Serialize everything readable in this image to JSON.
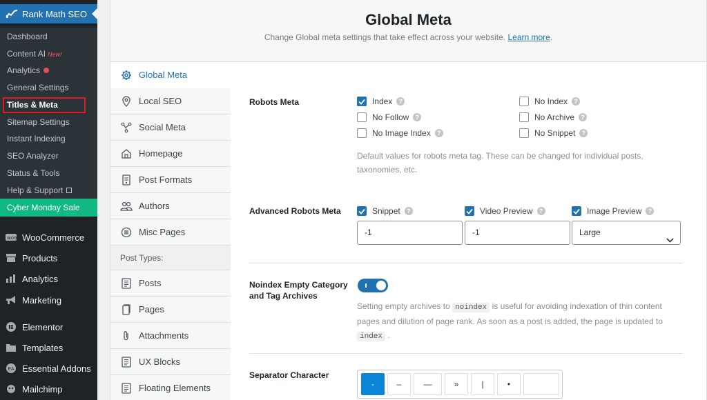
{
  "sidebar": {
    "plugin_title": "Rank Math SEO",
    "submenu": [
      {
        "label": "Dashboard"
      },
      {
        "label": "Content AI",
        "badge": "New!"
      },
      {
        "label": "Analytics"
      },
      {
        "label": "General Settings"
      },
      {
        "label": "Titles & Meta"
      },
      {
        "label": "Sitemap Settings"
      },
      {
        "label": "Instant Indexing"
      },
      {
        "label": "SEO Analyzer"
      },
      {
        "label": "Status & Tools"
      },
      {
        "label": "Help & Support"
      }
    ],
    "sale_label": "Cyber Monday Sale",
    "menu": [
      {
        "label": "WooCommerce",
        "icon": "woo-icon"
      },
      {
        "label": "Products",
        "icon": "archive-icon"
      },
      {
        "label": "Analytics",
        "icon": "bar-chart-icon"
      },
      {
        "label": "Marketing",
        "icon": "megaphone-icon"
      },
      {
        "label": "Elementor",
        "icon": "elementor-icon"
      },
      {
        "label": "Templates",
        "icon": "folder-icon"
      },
      {
        "label": "Essential Addons",
        "icon": "ea-icon"
      },
      {
        "label": "Mailchimp",
        "icon": "mailchimp-icon"
      }
    ]
  },
  "header": {
    "title": "Global Meta",
    "description": "Change Global meta settings that take effect across your website.",
    "learn_more": "Learn more",
    "period": "."
  },
  "nav": {
    "items": [
      {
        "label": "Global Meta",
        "icon": "gear-icon"
      },
      {
        "label": "Local SEO",
        "icon": "map-pin-icon"
      },
      {
        "label": "Social Meta",
        "icon": "share-icon"
      },
      {
        "label": "Homepage",
        "icon": "home-icon"
      },
      {
        "label": "Post Formats",
        "icon": "post-format-icon"
      },
      {
        "label": "Authors",
        "icon": "users-icon"
      },
      {
        "label": "Misc Pages",
        "icon": "list-icon"
      }
    ],
    "post_types_heading": "Post Types:",
    "post_types": [
      {
        "label": "Posts",
        "icon": "document-icon"
      },
      {
        "label": "Pages",
        "icon": "pages-icon"
      },
      {
        "label": "Attachments",
        "icon": "paperclip-icon"
      },
      {
        "label": "UX Blocks",
        "icon": "document-icon"
      },
      {
        "label": "Floating Elements",
        "icon": "document-icon"
      }
    ]
  },
  "robots_meta": {
    "label": "Robots Meta",
    "options": [
      {
        "label": "Index",
        "checked": true
      },
      {
        "label": "No Index",
        "checked": false
      },
      {
        "label": "No Follow",
        "checked": false
      },
      {
        "label": "No Archive",
        "checked": false
      },
      {
        "label": "No Image Index",
        "checked": false
      },
      {
        "label": "No Snippet",
        "checked": false
      }
    ],
    "description_line1": "Default values for robots meta tag. These can be changed for individual posts,",
    "description_line2": "taxonomies, etc."
  },
  "advanced_robots": {
    "label": "Advanced Robots Meta",
    "snippet_label": "Snippet",
    "snippet_value": "-1",
    "video_label": "Video Preview",
    "video_value": "-1",
    "image_label": "Image Preview",
    "image_value": "Large"
  },
  "noindex_empty": {
    "label_line1": "Noindex Empty Category",
    "label_line2": "and Tag Archives",
    "enabled": true,
    "desc_part1": "Setting empty archives to",
    "desc_code1": "noindex",
    "desc_part2": "is useful for avoiding indexation of thin content",
    "desc_line2": "pages and dilution of page rank. As soon as a post is added, the page is updated to",
    "desc_code2": "index",
    "desc_end": "."
  },
  "separator": {
    "label": "Separator Character",
    "options": [
      "-",
      "–",
      "—",
      "»",
      "|",
      "•"
    ],
    "selected": "-"
  },
  "colors": {
    "accent": "#2271b1",
    "sale": "#10b981",
    "sidebar_bg": "#1d2327"
  }
}
